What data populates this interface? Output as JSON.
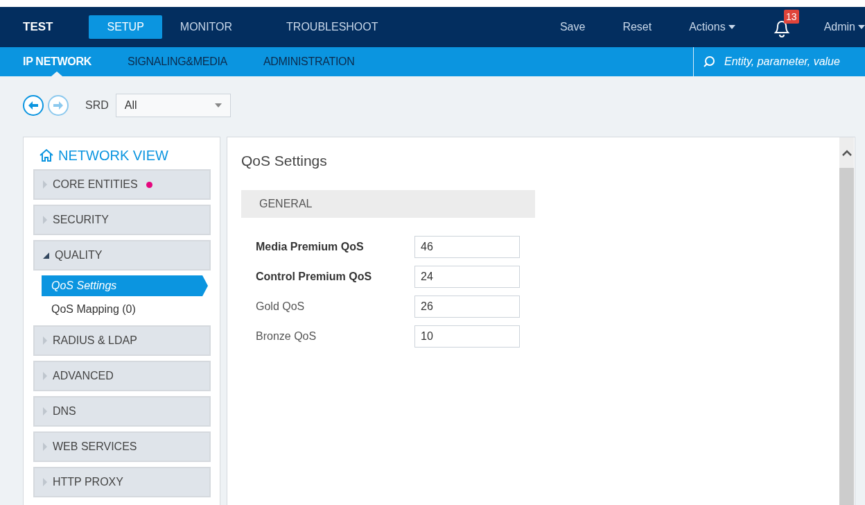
{
  "header": {
    "brand": "TEST",
    "tabs": [
      {
        "label": "SETUP",
        "selected": true
      },
      {
        "label": "MONITOR",
        "selected": false
      },
      {
        "label": "TROUBLESHOOT",
        "selected": false
      }
    ],
    "actions": [
      {
        "label": "Save",
        "kind": "plain"
      },
      {
        "label": "Reset",
        "kind": "plain"
      },
      {
        "label": "Actions",
        "kind": "menu"
      }
    ],
    "notifications": {
      "count": "13"
    },
    "user": {
      "label": "Admin"
    }
  },
  "subnav": {
    "tabs": [
      {
        "label": "IP NETWORK",
        "selected": true
      },
      {
        "label": "SIGNALING&MEDIA",
        "selected": false
      },
      {
        "label": "ADMINISTRATION",
        "selected": false
      }
    ],
    "search": {
      "placeholder": "Entity, parameter, value"
    }
  },
  "toolbar": {
    "back": {
      "disabled": false
    },
    "forward": {
      "disabled": true
    },
    "srd_label": "SRD",
    "srd_value": "All"
  },
  "sidebar": {
    "title": "NETWORK VIEW",
    "sections": [
      {
        "label": "CORE ENTITIES",
        "expanded": false,
        "alert": true
      },
      {
        "label": "SECURITY",
        "expanded": false,
        "alert": false
      },
      {
        "label": "QUALITY",
        "expanded": true,
        "alert": false,
        "children": [
          {
            "label": "QoS Settings",
            "selected": true
          },
          {
            "label": "QoS Mapping (0)",
            "selected": false
          }
        ]
      },
      {
        "label": "RADIUS & LDAP",
        "expanded": false,
        "alert": false
      },
      {
        "label": "ADVANCED",
        "expanded": false,
        "alert": false
      },
      {
        "label": "DNS",
        "expanded": false,
        "alert": false
      },
      {
        "label": "WEB SERVICES",
        "expanded": false,
        "alert": false
      },
      {
        "label": "HTTP PROXY",
        "expanded": false,
        "alert": false
      }
    ]
  },
  "content": {
    "title": "QoS Settings",
    "group": "GENERAL",
    "fields": [
      {
        "label": "Media Premium QoS",
        "value": "46",
        "emphasized": true
      },
      {
        "label": "Control Premium QoS",
        "value": "24",
        "emphasized": true
      },
      {
        "label": "Gold QoS",
        "value": "26",
        "emphasized": false
      },
      {
        "label": "Bronze QoS",
        "value": "10",
        "emphasized": false
      }
    ]
  }
}
